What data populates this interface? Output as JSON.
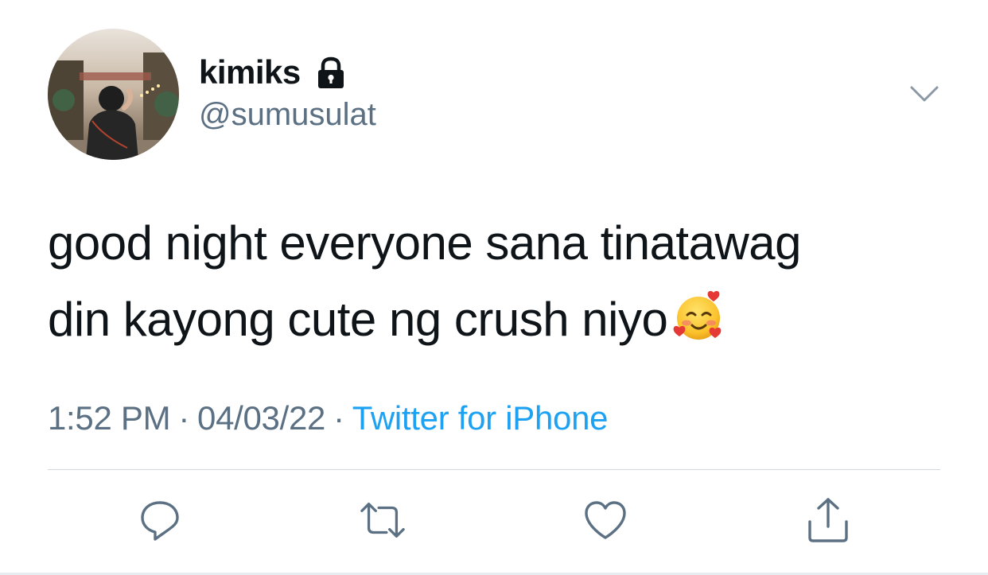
{
  "author": {
    "display_name": "kimiks",
    "handle": "@sumusulat",
    "protected_icon": "lock-icon",
    "avatar": "avatar-photo"
  },
  "tweet": {
    "line1": "good night everyone sana tinatawag",
    "line2": "din kayong cute ng crush niyo",
    "emoji": "smiling-face-with-hearts-emoji"
  },
  "meta": {
    "time": "1:52 PM",
    "separator": "·",
    "date": "04/03/22",
    "source": "Twitter for iPhone"
  },
  "actions": {
    "reply_icon": "reply-icon",
    "retweet_icon": "retweet-icon",
    "like_icon": "heart-icon",
    "share_icon": "share-icon",
    "menu_icon": "chevron-down-icon"
  },
  "colors": {
    "text": "#0f1419",
    "secondary": "#5b7083",
    "link": "#1da1f2",
    "divider": "#cfd9de"
  }
}
